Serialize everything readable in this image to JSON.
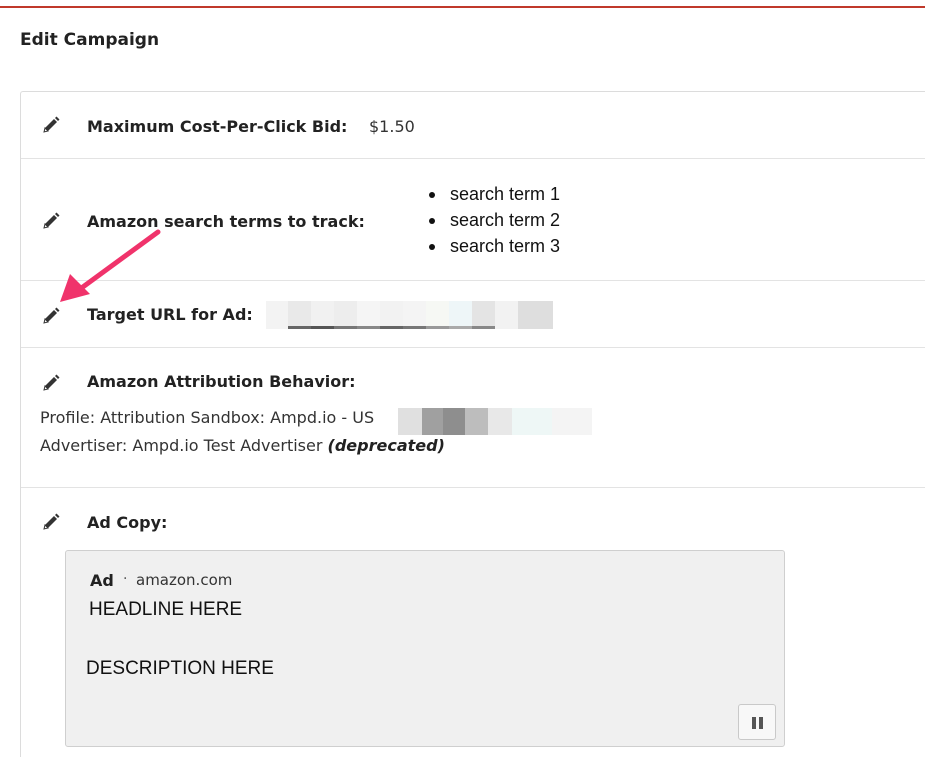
{
  "page": {
    "title": "Edit Campaign"
  },
  "bid": {
    "label": "Maximum Cost-Per-Click Bid:",
    "value": "$1.50"
  },
  "search_terms": {
    "label": "Amazon search terms to track:",
    "items": [
      "search term 1",
      "search term 2",
      "search term 3"
    ]
  },
  "target_url": {
    "label": "Target URL for Ad:"
  },
  "attribution": {
    "label": "Amazon Attribution Behavior:",
    "profile": "Profile: Attribution Sandbox: Ampd.io - US",
    "advertiser": "Advertiser: Ampd.io Test Advertiser",
    "advertiser_status": "(deprecated)"
  },
  "ad_copy": {
    "label": "Ad Copy:",
    "ad_tag": "Ad",
    "separator": "·",
    "domain": "amazon.com",
    "headline": "HEADLINE HERE",
    "description": "DESCRIPTION HERE"
  },
  "icons": {
    "edit": "pencil-icon",
    "pause": "pause-icon",
    "annotation": "arrow-icon"
  },
  "colors": {
    "accent_line": "#c0392b",
    "annotation_arrow": "#f0336b"
  }
}
